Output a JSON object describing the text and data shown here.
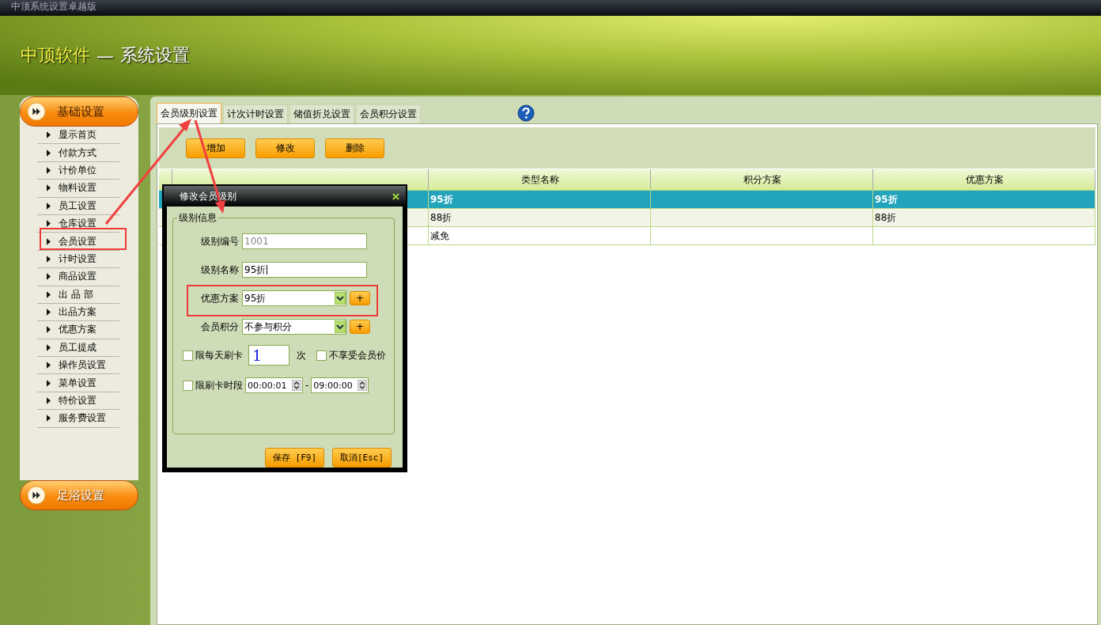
{
  "window": {
    "title": "中顶系统设置卓越版"
  },
  "banner": {
    "brand": "中顶软件",
    "separator": "—",
    "subtitle": "系统设置"
  },
  "sidebar": {
    "section": "基础设置",
    "items": [
      {
        "label": "显示首页",
        "selected": false
      },
      {
        "label": "付款方式",
        "selected": false
      },
      {
        "label": "计价单位",
        "selected": false
      },
      {
        "label": "物料设置",
        "selected": false
      },
      {
        "label": "员工设置",
        "selected": false
      },
      {
        "label": "仓库设置",
        "selected": false
      },
      {
        "label": "会员设置",
        "selected": false
      },
      {
        "label": "计时设置",
        "selected": false
      },
      {
        "label": "商品设置",
        "selected": false
      },
      {
        "label": "出 品 部",
        "selected": false
      },
      {
        "label": "出品方案",
        "selected": false
      },
      {
        "label": "优惠方案",
        "selected": false
      },
      {
        "label": "员工提成",
        "selected": false
      },
      {
        "label": "操作员设置",
        "selected": false
      },
      {
        "label": "菜单设置",
        "selected": false
      },
      {
        "label": "特价设置",
        "selected": false
      },
      {
        "label": "服务费设置",
        "selected": false
      }
    ],
    "bottom_section": "足浴设置"
  },
  "tabs": [
    {
      "label": "会员级别设置",
      "selected": true
    },
    {
      "label": "计次计时设置",
      "selected": false
    },
    {
      "label": "储值折兑设置",
      "selected": false
    },
    {
      "label": "会员积分设置",
      "selected": false
    }
  ],
  "toolbar": [
    "增加",
    "修改",
    "删除"
  ],
  "table": {
    "columns": [
      "类型名称",
      "积分方案",
      "优惠方案"
    ],
    "rows": [
      {
        "selected": true,
        "type_name": "95折",
        "discount_plan": "95折"
      },
      {
        "selected": false,
        "type_name": "88折",
        "discount_plan": "88折"
      },
      {
        "selected": false,
        "type_name": "减免"
      }
    ]
  },
  "dialog": {
    "title": "修改会员级别",
    "group": "级别信息",
    "level_code": {
      "label": "级别编号",
      "value": "1001",
      "disabled": true
    },
    "level_name": {
      "label": "级别名称",
      "value": "95折"
    },
    "discount": {
      "label": "优惠方案",
      "value": "95折",
      "add": "+"
    },
    "points": {
      "label": "会员积分",
      "value": "不参与积分",
      "add": "+"
    },
    "daily_limit": {
      "label": "限每天刷卡",
      "checked": false,
      "value": "1",
      "unit": "次"
    },
    "no_member_price": {
      "label": "不享受会员价",
      "checked": false
    },
    "time_limit": {
      "label": "限刷卡时段",
      "checked": false,
      "start": "00:00:01",
      "dash": "-",
      "end": "09:00:00"
    },
    "buttons": [
      "保存 [F9]",
      "取消[Esc]"
    ]
  }
}
